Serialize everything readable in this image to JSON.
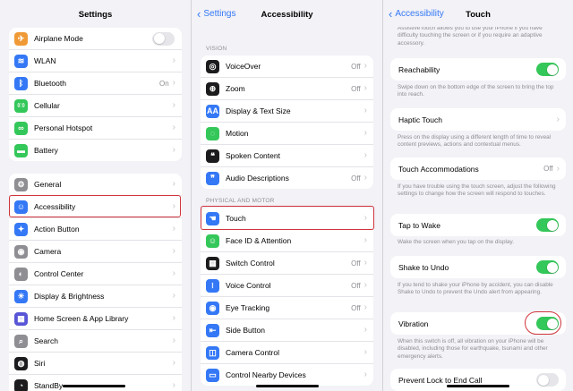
{
  "colors": {
    "accent": "#3478f6",
    "green": "#34c759",
    "highlight": "#d0343c"
  },
  "settings": {
    "title": "Settings",
    "group1": [
      {
        "label": "Airplane Mode",
        "icon": "airplane-icon",
        "color": "#f09a37",
        "glyph": "✈",
        "toggle": "off"
      },
      {
        "label": "WLAN",
        "icon": "wifi-icon",
        "color": "#3478f6",
        "glyph": "≋",
        "chevron": true
      },
      {
        "label": "Bluetooth",
        "icon": "bluetooth-icon",
        "color": "#3478f6",
        "glyph": "ᛒ",
        "value": "On",
        "chevron": true
      },
      {
        "label": "Cellular",
        "icon": "cellular-icon",
        "color": "#34c759",
        "glyph": "((·))",
        "chevron": true
      },
      {
        "label": "Personal Hotspot",
        "icon": "hotspot-icon",
        "color": "#34c759",
        "glyph": "∞",
        "chevron": true
      },
      {
        "label": "Battery",
        "icon": "battery-icon",
        "color": "#34c759",
        "glyph": "▬",
        "chevron": true
      }
    ],
    "group2": [
      {
        "label": "General",
        "icon": "gear-icon",
        "color": "#8e8e93",
        "glyph": "⚙",
        "chevron": true
      },
      {
        "label": "Accessibility",
        "icon": "accessibility-icon",
        "color": "#3478f6",
        "glyph": "☺",
        "chevron": true
      },
      {
        "label": "Action Button",
        "icon": "action-button-icon",
        "color": "#3478f6",
        "glyph": "✦",
        "chevron": true
      },
      {
        "label": "Camera",
        "icon": "camera-icon",
        "color": "#8e8e93",
        "glyph": "◉",
        "chevron": true
      },
      {
        "label": "Control Center",
        "icon": "control-center-icon",
        "color": "#8e8e93",
        "glyph": "◐",
        "chevron": true
      },
      {
        "label": "Display & Brightness",
        "icon": "brightness-icon",
        "color": "#3478f6",
        "glyph": "☀",
        "chevron": true
      },
      {
        "label": "Home Screen & App Library",
        "icon": "home-screen-icon",
        "color": "#5856d6",
        "glyph": "▦",
        "chevron": true
      },
      {
        "label": "Search",
        "icon": "search-icon",
        "color": "#8e8e93",
        "glyph": "⌕",
        "chevron": true
      },
      {
        "label": "Siri",
        "icon": "siri-icon",
        "color": "#1c1c1e",
        "glyph": "◍",
        "chevron": true
      },
      {
        "label": "StandBy",
        "icon": "standby-icon",
        "color": "#1c1c1e",
        "glyph": "◔",
        "chevron": true
      }
    ]
  },
  "accessibility": {
    "back": "Settings",
    "title": "Accessibility",
    "vision_header": "VISION",
    "vision": [
      {
        "label": "VoiceOver",
        "icon": "voiceover-icon",
        "color": "#1c1c1e",
        "glyph": "◎",
        "value": "Off"
      },
      {
        "label": "Zoom",
        "icon": "zoom-icon",
        "color": "#1c1c1e",
        "glyph": "⊕",
        "value": "Off"
      },
      {
        "label": "Display & Text Size",
        "icon": "text-size-icon",
        "color": "#3478f6",
        "glyph": "AA",
        "value": ""
      },
      {
        "label": "Motion",
        "icon": "motion-icon",
        "color": "#34c759",
        "glyph": "◌",
        "value": ""
      },
      {
        "label": "Spoken Content",
        "icon": "spoken-content-icon",
        "color": "#1c1c1e",
        "glyph": "❝",
        "value": ""
      },
      {
        "label": "Audio Descriptions",
        "icon": "audio-descriptions-icon",
        "color": "#3478f6",
        "glyph": "❞",
        "value": "Off"
      }
    ],
    "motor_header": "PHYSICAL AND MOTOR",
    "motor": [
      {
        "label": "Touch",
        "icon": "touch-icon",
        "color": "#3478f6",
        "glyph": "☚",
        "value": ""
      },
      {
        "label": "Face ID & Attention",
        "icon": "face-id-icon",
        "color": "#34c759",
        "glyph": "☺",
        "value": ""
      },
      {
        "label": "Switch Control",
        "icon": "switch-control-icon",
        "color": "#1c1c1e",
        "glyph": "▦",
        "value": "Off"
      },
      {
        "label": "Voice Control",
        "icon": "voice-control-icon",
        "color": "#3478f6",
        "glyph": "⧘",
        "value": "Off"
      },
      {
        "label": "Eye Tracking",
        "icon": "eye-tracking-icon",
        "color": "#3478f6",
        "glyph": "◉",
        "value": "Off"
      },
      {
        "label": "Side Button",
        "icon": "side-button-icon",
        "color": "#3478f6",
        "glyph": "⇤",
        "value": ""
      },
      {
        "label": "Camera Control",
        "icon": "camera-control-icon",
        "color": "#3478f6",
        "glyph": "◫",
        "value": ""
      },
      {
        "label": "Control Nearby Devices",
        "icon": "nearby-devices-icon",
        "color": "#3478f6",
        "glyph": "▭",
        "value": ""
      }
    ]
  },
  "touch": {
    "back": "Accessibility",
    "title": "Touch",
    "intro": "AssistiveTouch allows you to use your iPhone if you have difficulty touching the screen or if you require an adaptive accessory.",
    "reachability": {
      "label": "Reachability",
      "desc": "Swipe down on the bottom edge of the screen to bring the top into reach."
    },
    "haptic": {
      "label": "Haptic Touch",
      "desc": "Press on the display using a different length of time to reveal content previews, actions and contextual menus."
    },
    "accommodations": {
      "label": "Touch Accommodations",
      "value": "Off",
      "desc": "If you have trouble using the touch screen, adjust the following settings to change how the screen will respond to touches."
    },
    "tap_to_wake": {
      "label": "Tap to Wake",
      "desc": "Wake the screen when you tap on the display."
    },
    "shake_to_undo": {
      "label": "Shake to Undo",
      "desc": "If you tend to shake your iPhone by accident, you can disable Shake to Undo to prevent the Undo alert from appearing."
    },
    "vibration": {
      "label": "Vibration",
      "desc": "When this switch is off, all vibration on your iPhone will be disabled, including those for earthquake, tsunami and other emergency alerts."
    },
    "prevent_lock": {
      "label": "Prevent Lock to End Call"
    }
  }
}
